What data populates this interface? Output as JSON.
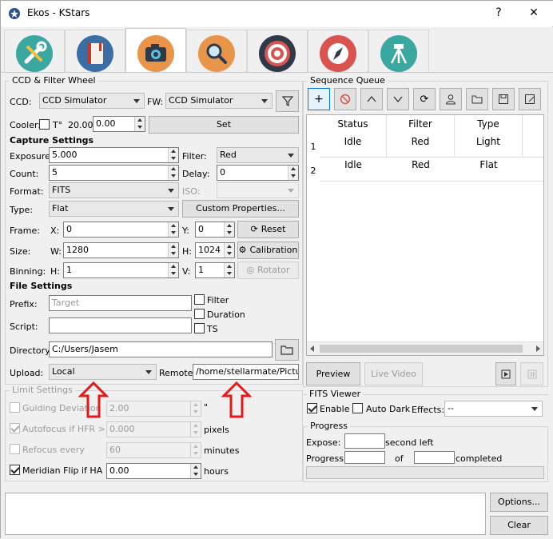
{
  "window": {
    "title": "Ekos - KStars",
    "help": "?",
    "close": "✕"
  },
  "tabs": [
    {
      "name": "setup",
      "color": "#3aa7a0"
    },
    {
      "name": "scheduler",
      "color": "#3b6ea5"
    },
    {
      "name": "capture",
      "color": "#e8954a"
    },
    {
      "name": "focus",
      "color": "#e8954a"
    },
    {
      "name": "align",
      "color": "#2e3a4a"
    },
    {
      "name": "guide",
      "color": "#d9534f"
    },
    {
      "name": "mount",
      "color": "#3aa7a0"
    }
  ],
  "ccd": {
    "group_title": "CCD & Filter Wheel",
    "ccd_label": "CCD:",
    "ccd_value": "CCD Simulator",
    "fw_label": "FW:",
    "fw_value": "CCD Simulator",
    "cooler_label": "Cooler:",
    "temp_label": "T°",
    "temp_value": "20.00",
    "temp_set": "0.00",
    "set_button": "Set"
  },
  "capture": {
    "section": "Capture Settings",
    "exposure_label": "Exposure:",
    "exposure": "5.000",
    "filter_label": "Filter:",
    "filter": "Red",
    "count_label": "Count:",
    "count": "5",
    "delay_label": "Delay:",
    "delay": "0",
    "format_label": "Format:",
    "format": "FITS",
    "iso_label": "ISO:",
    "type_label": "Type:",
    "type": "Flat",
    "custom_props": "Custom Properties...",
    "frame_label": "Frame:",
    "x_label": "X:",
    "x": "0",
    "y_label": "Y:",
    "y": "0",
    "reset": "Reset",
    "size_label": "Size:",
    "w_label": "W:",
    "w": "1280",
    "h_label": "H:",
    "h": "1024",
    "calibration": "Calibration",
    "binning_label": "Binning:",
    "bh_label": "H:",
    "bh": "1",
    "bv_label": "V:",
    "bv": "1",
    "rotator": "Rotator"
  },
  "file": {
    "section": "File Settings",
    "prefix_label": "Prefix:",
    "prefix_placeholder": "Target",
    "filter_chk": "Filter",
    "duration_chk": "Duration",
    "ts_chk": "TS",
    "script_label": "Script:",
    "directory_label": "Directory:",
    "directory": "C:/Users/Jasem",
    "upload_label": "Upload:",
    "upload": "Local",
    "remote_label": "Remote:",
    "remote": "/home/stellarmate/Pictures"
  },
  "limits": {
    "title": "Limit Settings",
    "guiding": "Guiding Deviation <",
    "guiding_value": "2.00",
    "guiding_unit": "\"",
    "autofocus": "Autofocus if HFR >",
    "autofocus_value": "0.000",
    "autofocus_unit": "pixels",
    "refocus": "Refocus every",
    "refocus_value": "60",
    "refocus_unit": "minutes",
    "meridian": "Meridian Flip if HA >",
    "meridian_value": "0.00",
    "meridian_unit": "hours"
  },
  "queue": {
    "title": "Sequence Queue",
    "columns": [
      "Status",
      "Filter",
      "Type"
    ],
    "rows": [
      {
        "n": "1",
        "status": "Idle",
        "filter": "Red",
        "type": "Light"
      },
      {
        "n": "2",
        "status": "Idle",
        "filter": "Red",
        "type": "Flat"
      }
    ],
    "preview": "Preview",
    "live_video": "Live Video"
  },
  "fits": {
    "title": "FITS Viewer",
    "enable": "Enable",
    "autodark": "Auto Dark",
    "effects_label": "Effects:",
    "effects": "--"
  },
  "progress": {
    "title": "Progress",
    "expose_label": "Expose:",
    "expose_suffix": "second left",
    "progress_label": "Progress:",
    "of": "of",
    "completed": "completed"
  },
  "log": {
    "options": "Options...",
    "clear": "Clear"
  }
}
